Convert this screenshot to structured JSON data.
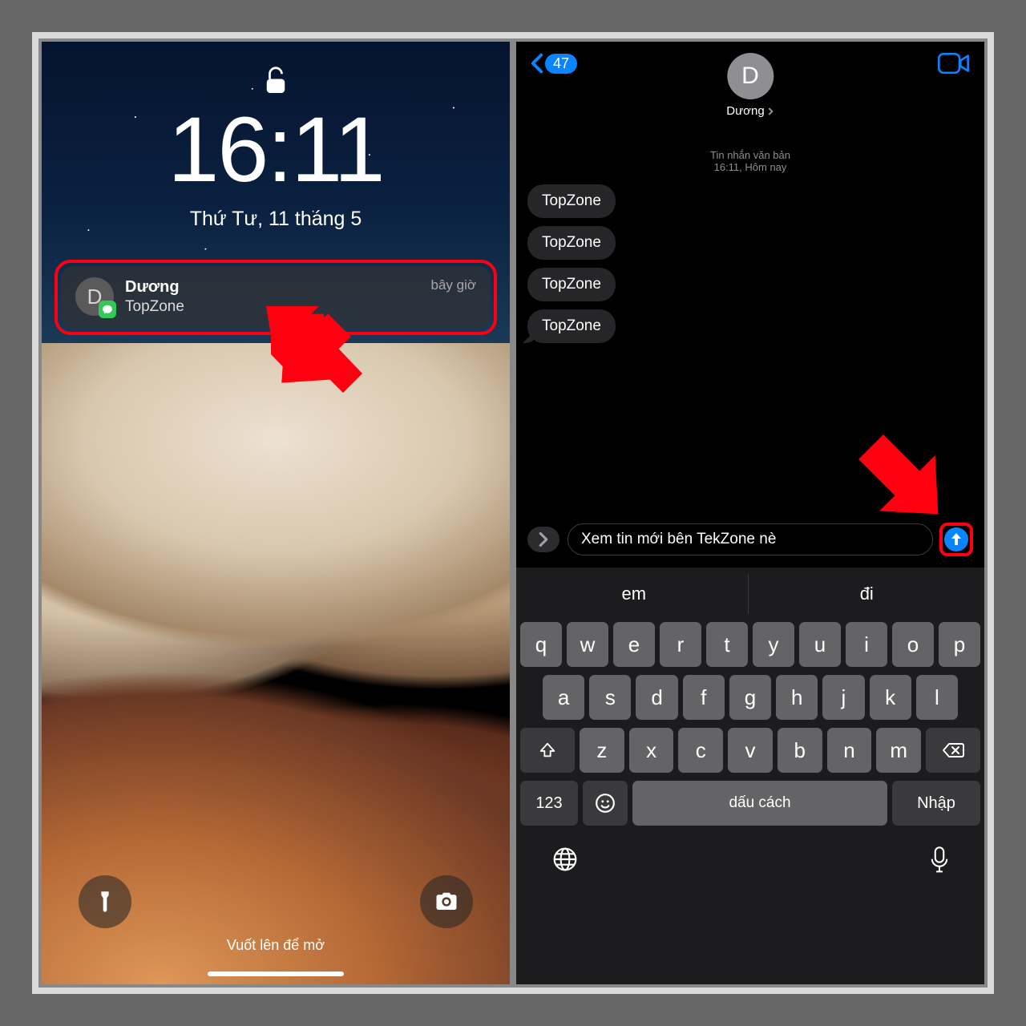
{
  "lock": {
    "time": "16:11",
    "date": "Thứ Tư, 11 tháng 5",
    "swipe": "Vuốt lên để mở"
  },
  "notif": {
    "avatar_letter": "D",
    "sender": "Dương",
    "preview": "TopZone",
    "timestamp": "bây giờ"
  },
  "chat": {
    "back_count": "47",
    "contact_letter": "D",
    "contact_name": "Dương",
    "thread_type": "Tin nhắn văn bản",
    "thread_time": "16:11, Hôm nay",
    "messages": [
      "TopZone",
      "TopZone",
      "TopZone",
      "TopZone"
    ],
    "compose_text": "Xem tin mới bên TekZone nè"
  },
  "keyboard": {
    "suggestions": [
      "em",
      "đi"
    ],
    "row1": [
      "q",
      "w",
      "e",
      "r",
      "t",
      "y",
      "u",
      "i",
      "o",
      "p"
    ],
    "row2": [
      "a",
      "s",
      "d",
      "f",
      "g",
      "h",
      "j",
      "k",
      "l"
    ],
    "row3": [
      "z",
      "x",
      "c",
      "v",
      "b",
      "n",
      "m"
    ],
    "num_label": "123",
    "space_label": "dấu cách",
    "enter_label": "Nhập"
  }
}
